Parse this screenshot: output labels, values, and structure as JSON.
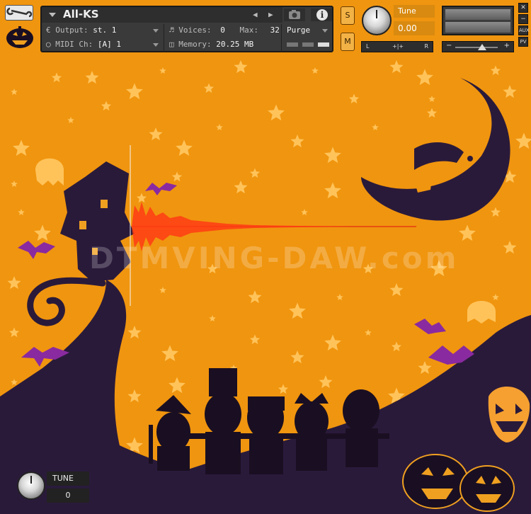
{
  "header": {
    "instrument_name": "All-KS",
    "output_label": "Output:",
    "output_value": "st. 1",
    "voices_label": "Voices:",
    "voices_value": "0",
    "max_label": "Max:",
    "max_value": "32",
    "purge_label": "Purge",
    "midi_label": "MIDI Ch:",
    "midi_value": "[A]  1",
    "memory_label": "Memory:",
    "memory_value": "20.25 MB",
    "solo_label": "S",
    "mute_label": "M",
    "tune_label": "Tune",
    "tune_value": "0.00",
    "pan_left": "L",
    "pan_center": "+|+",
    "pan_right": "R",
    "volume_minus": "−",
    "volume_plus": "+",
    "side_close": "✕",
    "side_minimize": "−",
    "side_aux": "AUX",
    "side_pv": "PV"
  },
  "watermark": "DTMVING-DAW.com",
  "footer": {
    "tune_label": "TUNE",
    "tune_value": "0"
  },
  "colors": {
    "background": "#f0950f",
    "silhouette": "#2a1a3a",
    "star": "#ffc35a",
    "bat": "#8a2aa0",
    "waveform": "#e53c10"
  },
  "icons": [
    "wrench-icon",
    "pumpkin-logo-icon",
    "camera-icon",
    "info-icon",
    "knob-icon",
    "moon-icon",
    "ghost-icon",
    "bat-icon",
    "star-icon",
    "jack-o-lantern-icon",
    "haunted-house-icon"
  ]
}
